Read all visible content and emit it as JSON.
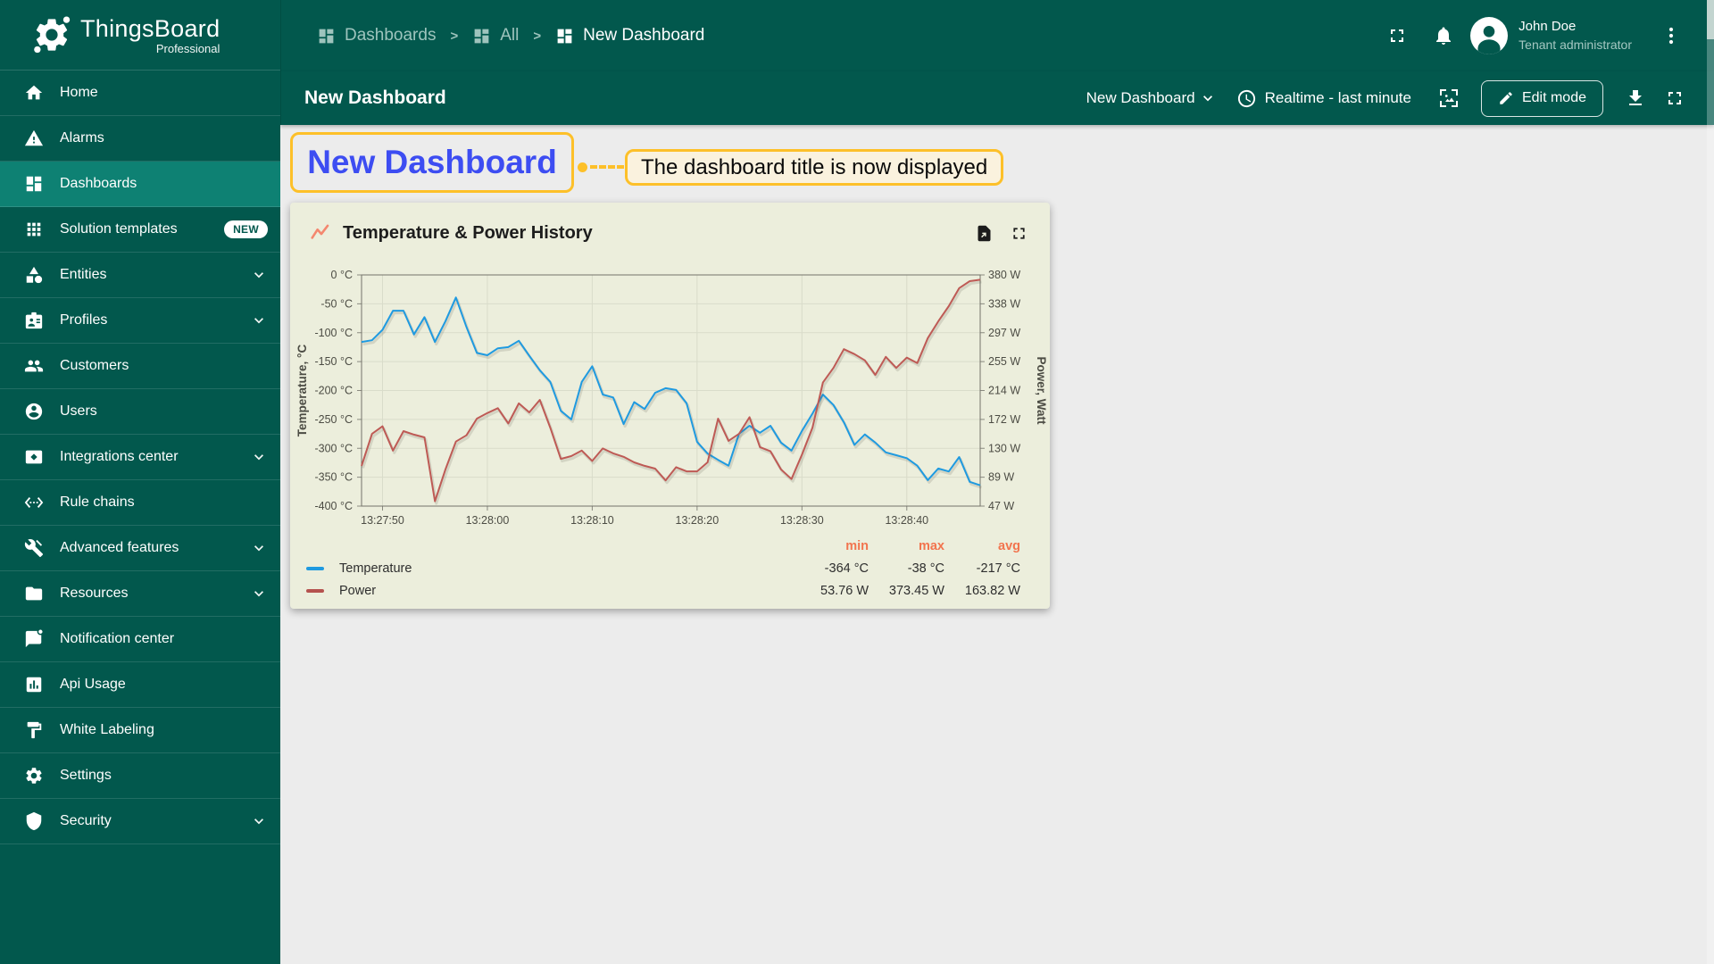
{
  "brand": {
    "name": "ThingsBoard",
    "edition": "Professional"
  },
  "breadcrumb": {
    "separator": ">",
    "items": [
      {
        "label": "Dashboards"
      },
      {
        "label": "All"
      },
      {
        "label": "New Dashboard"
      }
    ]
  },
  "topbar": {
    "user": {
      "name": "John Doe",
      "role": "Tenant administrator"
    }
  },
  "toolbar": {
    "page_title": "New Dashboard",
    "state_selector": "New Dashboard",
    "timewindow": "Realtime - last minute",
    "edit_button": "Edit mode"
  },
  "sidebar": {
    "items": [
      {
        "label": "Home",
        "icon": "home-icon"
      },
      {
        "label": "Alarms",
        "icon": "warning-icon"
      },
      {
        "label": "Dashboards",
        "icon": "dashboards-icon",
        "active": true
      },
      {
        "label": "Solution templates",
        "icon": "apps-grid-icon",
        "badge": "NEW"
      },
      {
        "label": "Entities",
        "icon": "category-icon",
        "expandable": true
      },
      {
        "label": "Profiles",
        "icon": "badge-icon",
        "expandable": true
      },
      {
        "label": "Customers",
        "icon": "people-icon"
      },
      {
        "label": "Users",
        "icon": "person-icon"
      },
      {
        "label": "Integrations center",
        "icon": "integration-icon",
        "expandable": true
      },
      {
        "label": "Rule chains",
        "icon": "rule-chain-icon"
      },
      {
        "label": "Advanced features",
        "icon": "tools-icon",
        "expandable": true
      },
      {
        "label": "Resources",
        "icon": "folder-icon",
        "expandable": true
      },
      {
        "label": "Notification center",
        "icon": "notification-icon"
      },
      {
        "label": "Api Usage",
        "icon": "bar-chart-icon"
      },
      {
        "label": "White Labeling",
        "icon": "paint-icon"
      },
      {
        "label": "Settings",
        "icon": "gear-icon"
      },
      {
        "label": "Security",
        "icon": "shield-icon",
        "expandable": true
      }
    ]
  },
  "annotation": {
    "highlighted_title": "New Dashboard",
    "tooltip": "The dashboard title is now displayed",
    "accent_color": "#FDC029",
    "title_color": "#3D4DF2"
  },
  "widget": {
    "title": "Temperature & Power History"
  },
  "chart_data": {
    "type": "line",
    "title": "Temperature & Power History",
    "x_axis_type": "time",
    "x_start": "13:27:48",
    "x_end": "13:28:47",
    "x_ticks": {
      "labels": [
        "13:27:50",
        "13:28:00",
        "13:28:10",
        "13:28:20",
        "13:28:30",
        "13:28:40"
      ],
      "indices": [
        2,
        12,
        22,
        32,
        42,
        52
      ]
    },
    "axes": {
      "left": {
        "label": "Temperature, °C",
        "range": [
          0,
          -400
        ],
        "tick_labels": [
          "0 °C",
          "-50 °C",
          "-100 °C",
          "-150 °C",
          "-200 °C",
          "-250 °C",
          "-300 °C",
          "-350 °C",
          "-400 °C"
        ]
      },
      "right": {
        "label": "Power, Watt",
        "range": [
          380,
          47
        ],
        "tick_labels": [
          "380 W",
          "338 W",
          "297 W",
          "255 W",
          "214 W",
          "172 W",
          "130 W",
          "89 W",
          "47 W"
        ]
      }
    },
    "grid": true,
    "legend_position": "bottom",
    "series": [
      {
        "name": "Temperature",
        "unit": "°C",
        "axis": "left",
        "color": "#1F9AE0",
        "values": [
          -116,
          -113,
          -95,
          -62,
          -62,
          -103,
          -73,
          -116,
          -80,
          -39,
          -90,
          -135,
          -139,
          -127,
          -125,
          -114,
          -140,
          -165,
          -185,
          -235,
          -250,
          -185,
          -158,
          -207,
          -212,
          -258,
          -220,
          -232,
          -204,
          -196,
          -199,
          -222,
          -289,
          -309,
          -320,
          -330,
          -275,
          -261,
          -273,
          -261,
          -290,
          -304,
          -270,
          -240,
          -207,
          -225,
          -255,
          -294,
          -276,
          -290,
          -307,
          -312,
          -317,
          -330,
          -355,
          -335,
          -340,
          -315,
          -358,
          -364
        ]
      },
      {
        "name": "Power",
        "unit": "W",
        "axis": "right",
        "color": "#BE5A55",
        "values": [
          105,
          151,
          162,
          127,
          155,
          150,
          146,
          54,
          100,
          140,
          149,
          173,
          181,
          188,
          166,
          195,
          182,
          200,
          160,
          115,
          119,
          127,
          112,
          130,
          123,
          118,
          110,
          105,
          101,
          84,
          103,
          97,
          97,
          110,
          173,
          141,
          151,
          175,
          132,
          126,
          100,
          86,
          121,
          160,
          225,
          246,
          273,
          266,
          257,
          236,
          262,
          246,
          261,
          253,
          289,
          313,
          335,
          361,
          371,
          373
        ]
      }
    ],
    "legend": {
      "columns": [
        "min",
        "max",
        "avg"
      ],
      "header_color": "#F2744E",
      "rows": [
        {
          "name": "Temperature",
          "min": "-364 °C",
          "max": "-38 °C",
          "avg": "-217 °C"
        },
        {
          "name": "Power",
          "min": "53.76 W",
          "max": "373.45 W",
          "avg": "163.82 W"
        }
      ]
    }
  }
}
